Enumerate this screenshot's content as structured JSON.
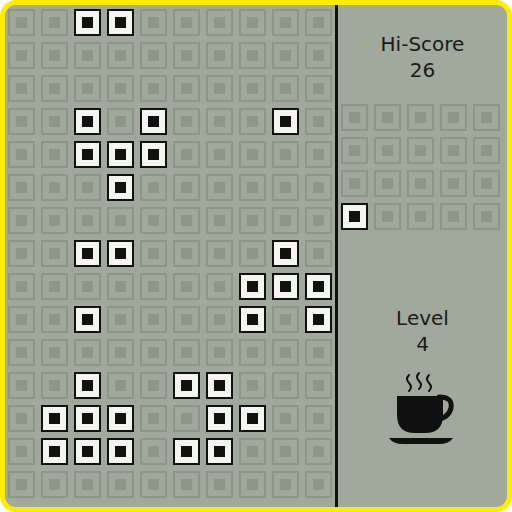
{
  "board": {
    "rows": [
      [
        false,
        false,
        true,
        true,
        false,
        false,
        false,
        false,
        false,
        false
      ],
      [
        false,
        false,
        false,
        false,
        false,
        false,
        false,
        false,
        false,
        false
      ],
      [
        false,
        false,
        false,
        false,
        false,
        false,
        false,
        false,
        false,
        false
      ],
      [
        false,
        false,
        true,
        false,
        true,
        false,
        false,
        false,
        true,
        false
      ],
      [
        false,
        false,
        true,
        true,
        true,
        false,
        false,
        false,
        false,
        false
      ],
      [
        false,
        false,
        false,
        true,
        false,
        false,
        false,
        false,
        false,
        false
      ],
      [
        false,
        false,
        false,
        false,
        false,
        false,
        false,
        false,
        false,
        false
      ],
      [
        false,
        false,
        true,
        true,
        false,
        false,
        false,
        false,
        true,
        false
      ],
      [
        false,
        false,
        false,
        false,
        false,
        false,
        false,
        true,
        true,
        true
      ],
      [
        false,
        false,
        true,
        false,
        false,
        false,
        false,
        true,
        false,
        true
      ],
      [
        false,
        false,
        false,
        false,
        false,
        false,
        false,
        false,
        false,
        false
      ],
      [
        false,
        false,
        true,
        false,
        false,
        true,
        true,
        false,
        false,
        false
      ],
      [
        false,
        true,
        true,
        true,
        false,
        false,
        true,
        true,
        false,
        false
      ],
      [
        false,
        true,
        true,
        true,
        false,
        true,
        true,
        false,
        false,
        false
      ],
      [
        false,
        false,
        false,
        false,
        false,
        false,
        false,
        false,
        false,
        false
      ]
    ]
  },
  "hi_score": {
    "label": "Hi-Score",
    "value": "26"
  },
  "next_piece": {
    "rows": [
      [
        false,
        false,
        false,
        false,
        false
      ],
      [
        false,
        false,
        false,
        false,
        false
      ],
      [
        false,
        false,
        false,
        false,
        false
      ],
      [
        true,
        false,
        false,
        false,
        false
      ]
    ]
  },
  "level": {
    "label": "Level",
    "value": "4"
  },
  "paused": true
}
